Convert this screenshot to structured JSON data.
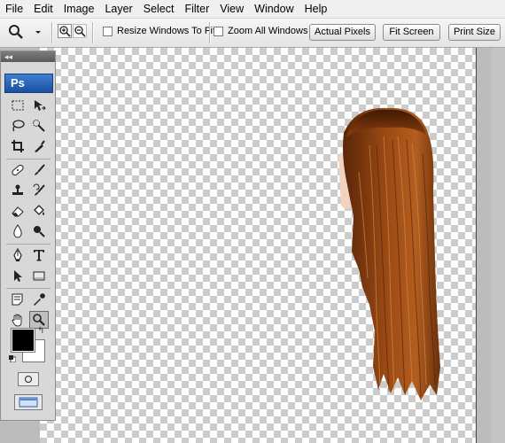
{
  "menu": [
    "File",
    "Edit",
    "Image",
    "Layer",
    "Select",
    "Filter",
    "View",
    "Window",
    "Help"
  ],
  "options_bar": {
    "tool_icon": "magnifier-icon",
    "zoom_in_icon": "zoom-in-icon",
    "zoom_out_icon": "zoom-out-icon",
    "resize_windows_label": "Resize Windows To Fit",
    "resize_windows_checked": false,
    "zoom_all_label": "Zoom All Windows",
    "zoom_all_checked": false,
    "actual_pixels_label": "Actual Pixels",
    "fit_screen_label": "Fit Screen",
    "print_size_label": "Print Size"
  },
  "tools_panel": {
    "logo": "Ps",
    "tools": [
      "rectangular-marquee-icon",
      "move-icon",
      "lasso-icon",
      "quick-selection-icon",
      "crop-icon",
      "slice-icon",
      "healing-brush-icon",
      "brush-icon",
      "clone-stamp-icon",
      "history-brush-icon",
      "eraser-icon",
      "paint-bucket-icon",
      "blur-icon",
      "dodge-icon",
      "pen-icon",
      "type-icon",
      "path-selection-icon",
      "rectangle-shape-icon",
      "notes-icon",
      "eyedropper-icon",
      "hand-icon",
      "zoom-tool-icon"
    ],
    "active_tool": "zoom-tool-icon",
    "foreground_color": "#000000",
    "background_color": "#ffffff"
  },
  "canvas": {
    "content": "hair-cutout-layer",
    "transparency": "checkerboard"
  },
  "colors": {
    "menu_bg": "#f0f0f0",
    "workspace_bg": "#bcbcbc",
    "logo_blue": "#1c4f9c"
  }
}
